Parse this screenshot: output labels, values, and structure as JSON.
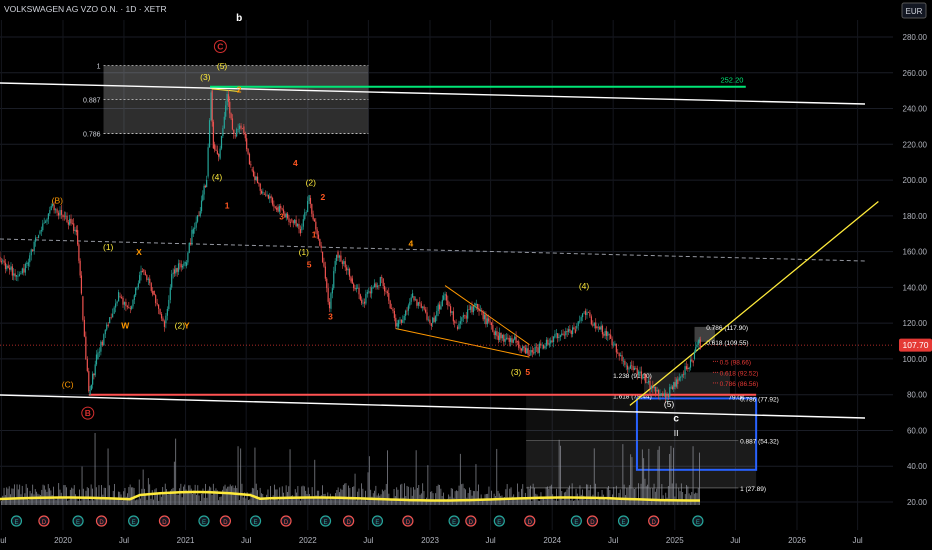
{
  "header": {
    "symbol": "VOLKSWAGEN AG VZO O.N. · 1D · XETR"
  },
  "currency_button": "EUR",
  "price_tag": {
    "value": "107.70",
    "color": "#e53935"
  },
  "chart_data": {
    "type": "line",
    "title": "VOLKSWAGEN AG VZO O.N. · 1D · XETR",
    "currency": "EUR",
    "ylim": [
      10,
      293
    ],
    "y_ticks": [
      20,
      40,
      60,
      80,
      100,
      120,
      140,
      160,
      180,
      200,
      220,
      240,
      260,
      280
    ],
    "x_ticks": [
      "Jul",
      "2020",
      "Jul",
      "2021",
      "Jul",
      "2022",
      "Jul",
      "2023",
      "Jul",
      "2024",
      "Jul",
      "2025",
      "Jul",
      "2026",
      "Jul"
    ],
    "x_range": [
      "2019-05",
      "2026-09"
    ],
    "series": [
      {
        "name": "",
        "color": "#26a69a",
        "points": [
          [
            "2019-05-15",
            155
          ],
          [
            "2019-07-01",
            155
          ],
          [
            "2019-08-15",
            146
          ],
          [
            "2019-09-15",
            152
          ],
          [
            "2019-10-20",
            170
          ],
          [
            "2019-12-01",
            186
          ],
          [
            "2020-01-01",
            180
          ],
          [
            "2020-02-10",
            172
          ],
          [
            "2020-02-25",
            135
          ],
          [
            "2020-03-18",
            80
          ],
          [
            "2020-04-10",
            100
          ],
          [
            "2020-05-15",
            120
          ],
          [
            "2020-06-15",
            135
          ],
          [
            "2020-07-20",
            128
          ],
          [
            "2020-08-25",
            150
          ],
          [
            "2020-09-25",
            138
          ],
          [
            "2020-10-30",
            120
          ],
          [
            "2020-11-25",
            150
          ],
          [
            "2020-12-31",
            152
          ],
          [
            "2021-01-20",
            170
          ],
          [
            "2021-02-10",
            180
          ],
          [
            "2021-03-05",
            202
          ],
          [
            "2021-03-18",
            250
          ],
          [
            "2021-03-25",
            220
          ],
          [
            "2021-04-10",
            212
          ],
          [
            "2021-05-05",
            248
          ],
          [
            "2021-05-25",
            225
          ],
          [
            "2021-06-20",
            230
          ],
          [
            "2021-07-15",
            206
          ],
          [
            "2021-08-20",
            192
          ],
          [
            "2021-09-30",
            185
          ],
          [
            "2021-11-10",
            178
          ],
          [
            "2021-12-10",
            172
          ],
          [
            "2022-01-05",
            190
          ],
          [
            "2022-02-10",
            160
          ],
          [
            "2022-03-07",
            128
          ],
          [
            "2022-03-28",
            160
          ],
          [
            "2022-05-10",
            145
          ],
          [
            "2022-06-15",
            132
          ],
          [
            "2022-08-10",
            145
          ],
          [
            "2022-09-25",
            118
          ],
          [
            "2022-11-10",
            135
          ],
          [
            "2023-01-05",
            120
          ],
          [
            "2023-02-15",
            136
          ],
          [
            "2023-03-20",
            118
          ],
          [
            "2023-05-15",
            130
          ],
          [
            "2023-07-20",
            113
          ],
          [
            "2023-09-15",
            110
          ],
          [
            "2023-10-25",
            102
          ],
          [
            "2024-01-05",
            112
          ],
          [
            "2024-03-10",
            117
          ],
          [
            "2024-04-05",
            127
          ],
          [
            "2024-05-10",
            118
          ],
          [
            "2024-06-15",
            114
          ],
          [
            "2024-08-05",
            96
          ],
          [
            "2024-09-15",
            92
          ],
          [
            "2024-11-05",
            82
          ],
          [
            "2024-12-05",
            79
          ],
          [
            "2025-01-10",
            88
          ],
          [
            "2025-02-05",
            95
          ],
          [
            "2025-02-25",
            100
          ],
          [
            "2025-03-12",
            109
          ],
          [
            "2025-03-18",
            107.7
          ]
        ]
      }
    ],
    "horizontal_line": {
      "value": 252.2,
      "label": "252.20",
      "color": "#00e676"
    },
    "fib_top": {
      "levels": [
        {
          "label": "1",
          "value": 264
        },
        {
          "label": "0.887",
          "value": 245
        },
        {
          "label": "0.786",
          "value": 226
        }
      ]
    },
    "fib_bottom": [
      {
        "label": "0.786 (117.90)",
        "value": 117.9
      },
      {
        "label": "0.618 (109.55)",
        "value": 109.55
      },
      {
        "label": "0.5 (98.66)",
        "value": 98.66
      },
      {
        "label": "0.618 (92.52)",
        "value": 92.52
      },
      {
        "label": "0.786 (86.56)",
        "value": 86.56
      },
      {
        "label": "1.238 (91.00)",
        "value": 91.0
      },
      {
        "label": "1.618 (79.44)",
        "value": 79.44
      },
      {
        "label": "79.06",
        "value": 79.06
      },
      {
        "label": "0.786 (77.92)",
        "value": 77.92
      },
      {
        "label": "0.887 (54.32)",
        "value": 54.32
      },
      {
        "label": "1 (27.89)",
        "value": 27.89
      }
    ],
    "wave_labels": [
      {
        "text": "b",
        "date": "2021-06-10",
        "value": 289,
        "color": "#ffffff"
      },
      {
        "text": "C",
        "date": "2021-04-15",
        "value": 273,
        "color": "#d32f2f",
        "circled": true
      },
      {
        "text": "(3)",
        "date": "2021-03-01",
        "value": 256,
        "color": "#ffeb3b"
      },
      {
        "text": "(5)",
        "date": "2021-04-20",
        "value": 262,
        "color": "#ffeb3b"
      },
      {
        "text": "2",
        "date": "2021-06-10",
        "value": 249,
        "color": "#ff9800"
      },
      {
        "text": "(4)",
        "date": "2021-04-05",
        "value": 200,
        "color": "#ffeb3b"
      },
      {
        "text": "1",
        "date": "2021-05-05",
        "value": 184,
        "color": "#ff5722"
      },
      {
        "text": "4",
        "date": "2021-11-25",
        "value": 208,
        "color": "#ff5722"
      },
      {
        "text": "(2)",
        "date": "2022-01-10",
        "value": 197,
        "color": "#ffeb3b"
      },
      {
        "text": "2",
        "date": "2022-02-15",
        "value": 189,
        "color": "#ff5722"
      },
      {
        "text": "3",
        "date": "2021-10-15",
        "value": 178,
        "color": "#ff5722"
      },
      {
        "text": "1",
        "date": "2022-01-20",
        "value": 168,
        "color": "#ff5722"
      },
      {
        "text": "(1)",
        "date": "2021-12-20",
        "value": 158,
        "color": "#ffeb3b"
      },
      {
        "text": "5",
        "date": "2022-01-05",
        "value": 151,
        "color": "#ff5722"
      },
      {
        "text": "4",
        "date": "2022-11-05",
        "value": 163,
        "color": "#ff9800"
      },
      {
        "text": "3",
        "date": "2022-03-10",
        "value": 122,
        "color": "#ff5722"
      },
      {
        "text": "(B)",
        "date": "2019-12-15",
        "value": 187,
        "color": "#ff9800"
      },
      {
        "text": "(1)",
        "date": "2020-05-15",
        "value": 161,
        "color": "#ffeb3b"
      },
      {
        "text": "X",
        "date": "2020-08-15",
        "value": 158,
        "color": "#ff9800"
      },
      {
        "text": "W",
        "date": "2020-07-05",
        "value": 117,
        "color": "#ff9800"
      },
      {
        "text": "(2)",
        "date": "2020-12-15",
        "value": 117,
        "color": "#ffeb3b"
      },
      {
        "text": "Y",
        "date": "2021-01-05",
        "value": 117,
        "color": "#ff9800"
      },
      {
        "text": "(C)",
        "date": "2020-01-15",
        "value": 84,
        "color": "#ff9800"
      },
      {
        "text": "B",
        "date": "2020-03-15",
        "value": 68,
        "color": "#d32f2f",
        "circled": true
      },
      {
        "text": "(4)",
        "date": "2024-04-05",
        "value": 139,
        "color": "#ffeb3b"
      },
      {
        "text": "(3)",
        "date": "2023-09-15",
        "value": 91,
        "color": "#ffeb3b"
      },
      {
        "text": "5",
        "date": "2023-10-20",
        "value": 91,
        "color": "#ff5722"
      },
      {
        "text": "(5)",
        "date": "2024-12-15",
        "value": 73,
        "color": "#ffffff"
      },
      {
        "text": "c",
        "date": "2025-01-05",
        "value": 65,
        "color": "#ffffff"
      },
      {
        "text": "II",
        "date": "2025-01-05",
        "value": 57,
        "color": "#ffffff"
      }
    ],
    "volume_axis_note": "Volume histogram with moving average",
    "events_row": [
      "E",
      "D"
    ]
  }
}
